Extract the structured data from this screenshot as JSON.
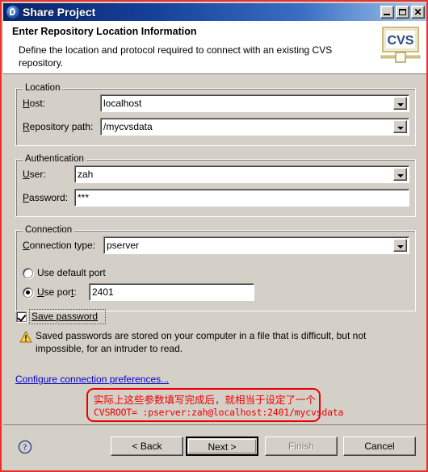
{
  "window": {
    "title": "Share Project",
    "app_icon": "eclipse-icon",
    "controls": {
      "minimize": "minimize-icon",
      "maximize": "maximize-icon",
      "close": "close-icon"
    }
  },
  "header": {
    "title": "Enter Repository Location Information",
    "description": "Define the location and protocol required to connect with an existing CVS repository.",
    "logo_text": "CVS"
  },
  "location": {
    "legend": "Location",
    "host_label": "Host:",
    "host_value": "localhost",
    "repo_label": "Repository path:",
    "repo_value": "/mycvsdata"
  },
  "authentication": {
    "legend": "Authentication",
    "user_label": "User:",
    "user_value": "zah",
    "password_label": "Password:",
    "password_value": "***"
  },
  "connection": {
    "legend": "Connection",
    "type_label": "Connection type:",
    "type_value": "pserver",
    "default_port_label": "Use default port",
    "default_port_selected": false,
    "use_port_label": "Use port:",
    "use_port_selected": true,
    "port_value": "2401"
  },
  "save_password": {
    "label": "Save password",
    "checked": true,
    "warning_icon": "warning-triangle-icon",
    "warning_text": "Saved passwords are stored on your computer in a file that is difficult, but not impossible, for an intruder to read."
  },
  "link": {
    "configure": "Configure connection preferences..."
  },
  "annotation": {
    "line1": "实际上这些参数填写完成后，就相当于设定了一个",
    "line2": "CVSROOT= :pserver:zah@localhost:2401/mycvsdata",
    "color": "#ee0000"
  },
  "buttons": {
    "help": "help-icon",
    "back": "< Back",
    "next": "Next >",
    "finish": "Finish",
    "cancel": "Cancel"
  },
  "colors": {
    "dialog_bg": "#d4d0c8",
    "title_start": "#0a246a",
    "title_end": "#a6c8ee",
    "border_red": "#e8302c",
    "link_blue": "#0000cc"
  }
}
